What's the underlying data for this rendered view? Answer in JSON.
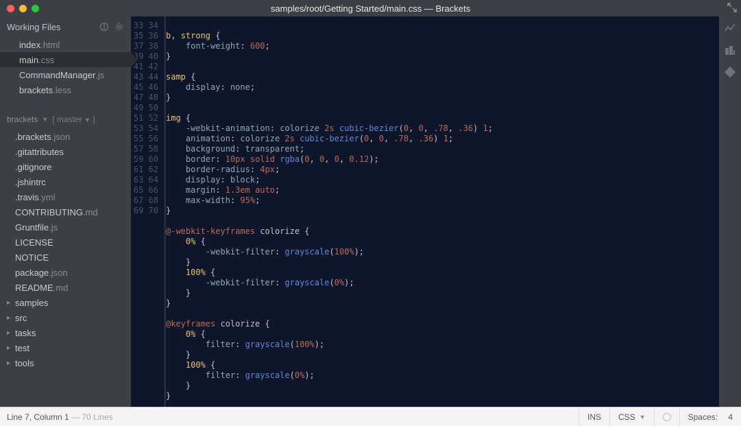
{
  "window": {
    "title": "samples/root/Getting Started/main.css — Brackets"
  },
  "sidebar": {
    "working_files_label": "Working Files",
    "working_files": [
      {
        "name": "index",
        "ext": ".html",
        "active": false
      },
      {
        "name": "main",
        "ext": ".css",
        "active": true
      },
      {
        "name": "CommandManager",
        "ext": ".js",
        "active": false
      },
      {
        "name": "brackets",
        "ext": ".less",
        "active": false
      }
    ],
    "project_name": "brackets",
    "branch_name": "master",
    "tree": [
      {
        "name": ".brackets",
        "ext": ".json",
        "folder": false
      },
      {
        "name": ".gitattributes",
        "ext": "",
        "folder": false
      },
      {
        "name": ".gitignore",
        "ext": "",
        "folder": false
      },
      {
        "name": ".jshintrc",
        "ext": "",
        "folder": false
      },
      {
        "name": ".travis",
        "ext": ".yml",
        "folder": false
      },
      {
        "name": "CONTRIBUTING",
        "ext": ".md",
        "folder": false
      },
      {
        "name": "Gruntfile",
        "ext": ".js",
        "folder": false
      },
      {
        "name": "LICENSE",
        "ext": "",
        "folder": false
      },
      {
        "name": "NOTICE",
        "ext": "",
        "folder": false
      },
      {
        "name": "package",
        "ext": ".json",
        "folder": false
      },
      {
        "name": "README",
        "ext": ".md",
        "folder": false
      },
      {
        "name": "samples",
        "ext": "",
        "folder": true
      },
      {
        "name": "src",
        "ext": "",
        "folder": true
      },
      {
        "name": "tasks",
        "ext": "",
        "folder": true
      },
      {
        "name": "test",
        "ext": "",
        "folder": true
      },
      {
        "name": "tools",
        "ext": "",
        "folder": true
      }
    ]
  },
  "editor": {
    "first_line_no": 33,
    "last_line_no": 70,
    "lines": [
      {
        "n": 33,
        "t": []
      },
      {
        "n": 34,
        "t": [
          [
            "sel",
            "b"
          ],
          [
            "punc",
            ", "
          ],
          [
            "sel",
            "strong"
          ],
          [
            "punc",
            " {"
          ]
        ]
      },
      {
        "n": 35,
        "t": [
          [
            "ind",
            "    "
          ],
          [
            "prop",
            "font-weight"
          ],
          [
            "punc",
            ": "
          ],
          [
            "num",
            "600"
          ],
          [
            "punc",
            ";"
          ]
        ]
      },
      {
        "n": 36,
        "t": [
          [
            "punc",
            "}"
          ]
        ]
      },
      {
        "n": 37,
        "t": []
      },
      {
        "n": 38,
        "t": [
          [
            "sel",
            "samp"
          ],
          [
            "punc",
            " {"
          ]
        ]
      },
      {
        "n": 39,
        "t": [
          [
            "ind",
            "    "
          ],
          [
            "prop",
            "display"
          ],
          [
            "punc",
            ": "
          ],
          [
            "val",
            "none"
          ],
          [
            "punc",
            ";"
          ]
        ]
      },
      {
        "n": 40,
        "t": [
          [
            "punc",
            "}"
          ]
        ]
      },
      {
        "n": 41,
        "t": []
      },
      {
        "n": 42,
        "t": [
          [
            "sel",
            "img"
          ],
          [
            "punc",
            " {"
          ]
        ]
      },
      {
        "n": 43,
        "t": [
          [
            "ind",
            "    "
          ],
          [
            "prop",
            "-webkit-animation"
          ],
          [
            "punc",
            ": "
          ],
          [
            "val",
            "colorize "
          ],
          [
            "num",
            "2s"
          ],
          [
            "punc",
            " "
          ],
          [
            "func",
            "cubic-bezier"
          ],
          [
            "punc",
            "("
          ],
          [
            "num",
            "0"
          ],
          [
            "punc",
            ", "
          ],
          [
            "num",
            "0"
          ],
          [
            "punc",
            ", "
          ],
          [
            "num",
            ".78"
          ],
          [
            "punc",
            ", "
          ],
          [
            "num",
            ".36"
          ],
          [
            "punc",
            ") "
          ],
          [
            "num",
            "1"
          ],
          [
            "punc",
            ";"
          ]
        ]
      },
      {
        "n": 44,
        "t": [
          [
            "ind",
            "    "
          ],
          [
            "prop",
            "animation"
          ],
          [
            "punc",
            ": "
          ],
          [
            "val",
            "colorize "
          ],
          [
            "num",
            "2s"
          ],
          [
            "punc",
            " "
          ],
          [
            "func",
            "cubic-bezier"
          ],
          [
            "punc",
            "("
          ],
          [
            "num",
            "0"
          ],
          [
            "punc",
            ", "
          ],
          [
            "num",
            "0"
          ],
          [
            "punc",
            ", "
          ],
          [
            "num",
            ".78"
          ],
          [
            "punc",
            ", "
          ],
          [
            "num",
            ".36"
          ],
          [
            "punc",
            ") "
          ],
          [
            "num",
            "1"
          ],
          [
            "punc",
            ";"
          ]
        ]
      },
      {
        "n": 45,
        "t": [
          [
            "ind",
            "    "
          ],
          [
            "prop",
            "background"
          ],
          [
            "punc",
            ": "
          ],
          [
            "val",
            "transparent"
          ],
          [
            "punc",
            ";"
          ]
        ]
      },
      {
        "n": 46,
        "t": [
          [
            "ind",
            "    "
          ],
          [
            "prop",
            "border"
          ],
          [
            "punc",
            ": "
          ],
          [
            "num",
            "10px"
          ],
          [
            "punc",
            " "
          ],
          [
            "kw",
            "solid"
          ],
          [
            "punc",
            " "
          ],
          [
            "func",
            "rgba"
          ],
          [
            "punc",
            "("
          ],
          [
            "num",
            "0"
          ],
          [
            "punc",
            ", "
          ],
          [
            "num",
            "0"
          ],
          [
            "punc",
            ", "
          ],
          [
            "num",
            "0"
          ],
          [
            "punc",
            ", "
          ],
          [
            "num",
            "0.12"
          ],
          [
            "punc",
            ");"
          ]
        ]
      },
      {
        "n": 47,
        "t": [
          [
            "ind",
            "    "
          ],
          [
            "prop",
            "border-radius"
          ],
          [
            "punc",
            ": "
          ],
          [
            "num",
            "4px"
          ],
          [
            "punc",
            ";"
          ]
        ]
      },
      {
        "n": 48,
        "t": [
          [
            "ind",
            "    "
          ],
          [
            "prop",
            "display"
          ],
          [
            "punc",
            ": "
          ],
          [
            "val",
            "block"
          ],
          [
            "punc",
            ";"
          ]
        ]
      },
      {
        "n": 49,
        "t": [
          [
            "ind",
            "    "
          ],
          [
            "prop",
            "margin"
          ],
          [
            "punc",
            ": "
          ],
          [
            "num",
            "1.3em"
          ],
          [
            "punc",
            " "
          ],
          [
            "kw",
            "auto"
          ],
          [
            "punc",
            ";"
          ]
        ]
      },
      {
        "n": 50,
        "t": [
          [
            "ind",
            "    "
          ],
          [
            "prop",
            "max-width"
          ],
          [
            "punc",
            ": "
          ],
          [
            "num",
            "95%"
          ],
          [
            "punc",
            ";"
          ]
        ]
      },
      {
        "n": 51,
        "t": [
          [
            "punc",
            "}"
          ]
        ]
      },
      {
        "n": 52,
        "t": []
      },
      {
        "n": 53,
        "t": [
          [
            "at",
            "@-webkit-keyframes"
          ],
          [
            "punc",
            " "
          ],
          [
            "atid",
            "colorize"
          ],
          [
            "punc",
            " {"
          ]
        ]
      },
      {
        "n": 54,
        "t": [
          [
            "ind",
            "    "
          ],
          [
            "pct",
            "0%"
          ],
          [
            "punc",
            " {"
          ]
        ]
      },
      {
        "n": 55,
        "t": [
          [
            "ind",
            "        "
          ],
          [
            "prop",
            "-webkit-filter"
          ],
          [
            "punc",
            ": "
          ],
          [
            "func",
            "grayscale"
          ],
          [
            "punc",
            "("
          ],
          [
            "num",
            "100%"
          ],
          [
            "punc",
            ");"
          ]
        ]
      },
      {
        "n": 56,
        "t": [
          [
            "ind",
            "    "
          ],
          [
            "punc",
            "}"
          ]
        ]
      },
      {
        "n": 57,
        "t": [
          [
            "ind",
            "    "
          ],
          [
            "pct",
            "100%"
          ],
          [
            "punc",
            " {"
          ]
        ]
      },
      {
        "n": 58,
        "t": [
          [
            "ind",
            "        "
          ],
          [
            "prop",
            "-webkit-filter"
          ],
          [
            "punc",
            ": "
          ],
          [
            "func",
            "grayscale"
          ],
          [
            "punc",
            "("
          ],
          [
            "num",
            "0%"
          ],
          [
            "punc",
            ");"
          ]
        ]
      },
      {
        "n": 59,
        "t": [
          [
            "ind",
            "    "
          ],
          [
            "punc",
            "}"
          ]
        ]
      },
      {
        "n": 60,
        "t": [
          [
            "punc",
            "}"
          ]
        ]
      },
      {
        "n": 61,
        "t": []
      },
      {
        "n": 62,
        "t": [
          [
            "at",
            "@keyframes"
          ],
          [
            "punc",
            " "
          ],
          [
            "atid",
            "colorize"
          ],
          [
            "punc",
            " {"
          ]
        ]
      },
      {
        "n": 63,
        "t": [
          [
            "ind",
            "    "
          ],
          [
            "pct",
            "0%"
          ],
          [
            "punc",
            " {"
          ]
        ]
      },
      {
        "n": 64,
        "t": [
          [
            "ind",
            "        "
          ],
          [
            "prop",
            "filter"
          ],
          [
            "punc",
            ": "
          ],
          [
            "func",
            "grayscale"
          ],
          [
            "punc",
            "("
          ],
          [
            "num",
            "100%"
          ],
          [
            "punc",
            ");"
          ]
        ]
      },
      {
        "n": 65,
        "t": [
          [
            "ind",
            "    "
          ],
          [
            "punc",
            "}"
          ]
        ]
      },
      {
        "n": 66,
        "t": [
          [
            "ind",
            "    "
          ],
          [
            "pct",
            "100%"
          ],
          [
            "punc",
            " {"
          ]
        ]
      },
      {
        "n": 67,
        "t": [
          [
            "ind",
            "        "
          ],
          [
            "prop",
            "filter"
          ],
          [
            "punc",
            ": "
          ],
          [
            "func",
            "grayscale"
          ],
          [
            "punc",
            "("
          ],
          [
            "num",
            "0%"
          ],
          [
            "punc",
            ");"
          ]
        ]
      },
      {
        "n": 68,
        "t": [
          [
            "ind",
            "    "
          ],
          [
            "punc",
            "}"
          ]
        ]
      },
      {
        "n": 69,
        "t": [
          [
            "punc",
            "}"
          ]
        ]
      },
      {
        "n": 70,
        "t": []
      }
    ]
  },
  "status": {
    "cursor": "Line 7, Column 1",
    "lines_info": " — 70 Lines",
    "insert_mode": "INS",
    "language": "CSS",
    "spaces_label": "Spaces:",
    "spaces_value": "4"
  }
}
